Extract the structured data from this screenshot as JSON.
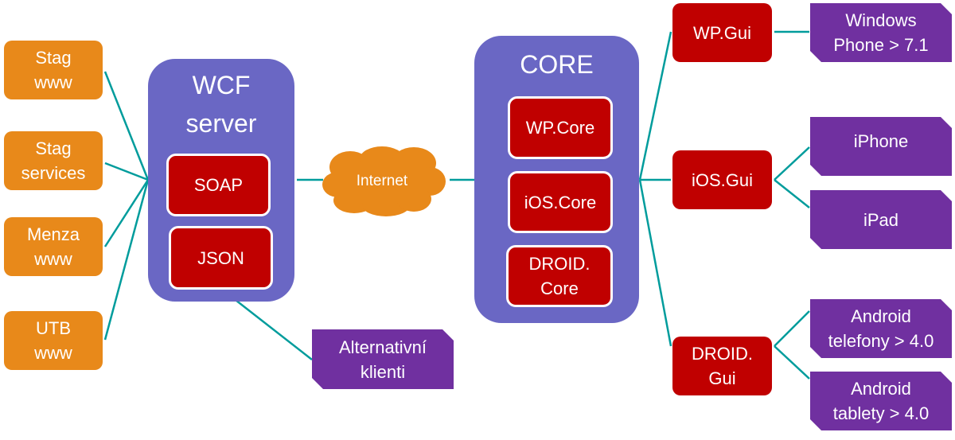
{
  "colors": {
    "source": "#E8891A",
    "module": "#C00000",
    "group": "#6A67C4",
    "client": "#7030A0",
    "connector": "#009C9C"
  },
  "sources": [
    {
      "l1": "Stag",
      "l2": "www"
    },
    {
      "l1": "Stag",
      "l2": "services"
    },
    {
      "l1": "Menza",
      "l2": "www"
    },
    {
      "l1": "UTB",
      "l2": "www"
    }
  ],
  "wcf": {
    "title1": "WCF",
    "title2": "server",
    "soap": "SOAP",
    "json": "JSON"
  },
  "internet": "Internet",
  "core": {
    "title": "CORE",
    "wp": "WP.Core",
    "ios": "iOS.Core",
    "droid1": "DROID.",
    "droid2": "Core"
  },
  "alt": {
    "l1": "Alternativní",
    "l2": "klienti"
  },
  "gui": {
    "wp": "WP.Gui",
    "ios": "iOS.Gui",
    "droid1": "DROID.",
    "droid2": "Gui"
  },
  "clients": {
    "wp": {
      "l1": "Windows",
      "l2": "Phone > 7.1"
    },
    "iphone": "iPhone",
    "ipad": "iPad",
    "android_phone": {
      "l1": "Android",
      "l2": "telefony > 4.0"
    },
    "android_tablet": {
      "l1": "Android",
      "l2": "tablety > 4.0"
    }
  }
}
